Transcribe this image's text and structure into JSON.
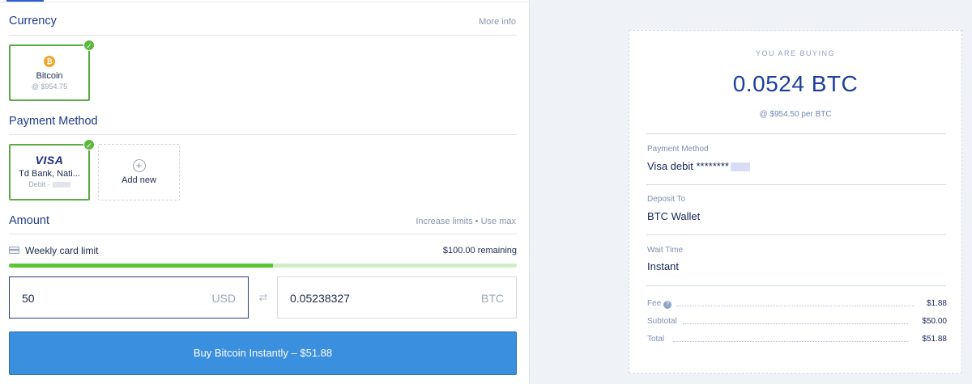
{
  "currency": {
    "title": "Currency",
    "more_info": "More info",
    "selected": {
      "icon": "bitcoin-icon",
      "name": "Bitcoin",
      "price": "@ $954.75"
    }
  },
  "payment": {
    "title": "Payment Method",
    "selected": {
      "brand": "VISA",
      "name": "Td Bank, Nati...",
      "type": "Debit ·"
    },
    "add_new": "Add new"
  },
  "amount": {
    "title": "Amount",
    "links": "Increase limits  •  Use max",
    "limit_label": "Weekly card limit",
    "limit_remaining": "$100.00 remaining",
    "limit_used_fraction": 0.52,
    "usd_value": "50",
    "usd_unit": "USD",
    "btc_value": "0.05238327",
    "btc_unit": "BTC"
  },
  "buy_button": "Buy Bitcoin Instantly – $51.88",
  "summary": {
    "buying_label": "YOU ARE BUYING",
    "amount": "0.0524 BTC",
    "rate": "@ $954.50 per BTC",
    "payment_label": "Payment Method",
    "payment_value": "Visa debit ********",
    "deposit_label": "Deposit To",
    "deposit_value": "BTC Wallet",
    "wait_label": "Wait Time",
    "wait_value": "Instant",
    "fee_label": "Fee",
    "fee_value": "$1.88",
    "subtotal_label": "Subtotal",
    "subtotal_value": "$50.00",
    "total_label": "Total",
    "total_value": "$51.88"
  },
  "colors": {
    "accent_blue": "#3b8fdf",
    "selected_green": "#5cab46",
    "progress_green": "#58c532",
    "heading_navy": "#1f3c8a"
  }
}
